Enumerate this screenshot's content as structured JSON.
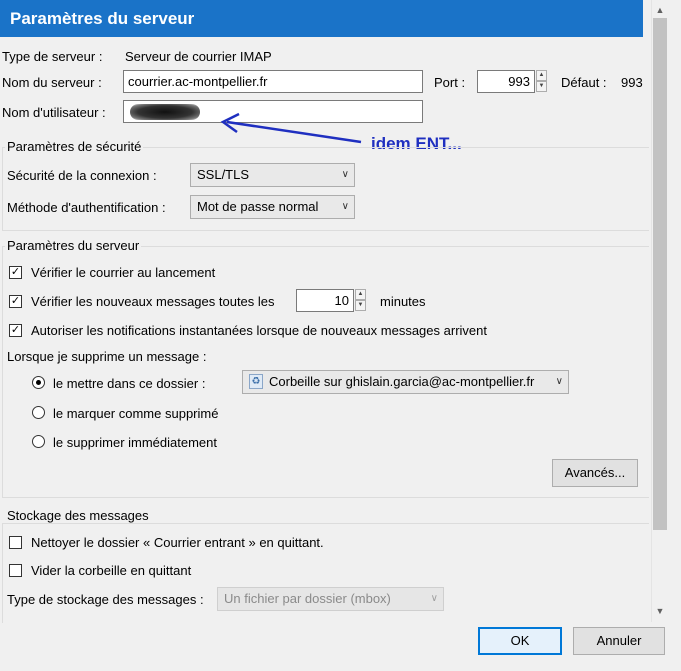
{
  "window": {
    "title": "Paramètres du serveur"
  },
  "server": {
    "type_label": "Type de serveur :",
    "type_value": "Serveur de courrier IMAP",
    "name_label": "Nom du serveur :",
    "name_value": "courrier.ac-montpellier.fr",
    "port_label": "Port :",
    "port_value": "993",
    "default_label": "Défaut :",
    "default_value": "993",
    "username_label": "Nom d'utilisateur :"
  },
  "annotation": {
    "text": "idem ENT...",
    "color": "#1f2fc0"
  },
  "security": {
    "group_label": "Paramètres de sécurité",
    "connection_label": "Sécurité de la connexion :",
    "connection_value": "SSL/TLS",
    "auth_label": "Méthode d'authentification :",
    "auth_value": "Mot de passe normal"
  },
  "server_settings": {
    "group_label": "Paramètres du serveur",
    "check_startup": {
      "label": "Vérifier le courrier au lancement",
      "checked": true
    },
    "check_new": {
      "label": "Vérifier les nouveaux messages toutes les",
      "checked": true,
      "value": "10",
      "unit": "minutes"
    },
    "notifications": {
      "label": "Autoriser les notifications instantanées lorsque de nouveaux messages arrivent",
      "checked": true
    },
    "delete_label": "Lorsque je supprime un message :",
    "delete_options": [
      {
        "label": "le mettre dans ce dossier :",
        "selected": true
      },
      {
        "label": "le marquer comme supprimé",
        "selected": false
      },
      {
        "label": "le supprimer immédiatement",
        "selected": false
      }
    ],
    "trash_folder": "Corbeille sur ghislain.garcia@ac-montpellier.fr",
    "advanced_button": "Avancés..."
  },
  "storage": {
    "group_label": "Stockage des messages",
    "cleanup_inbox": {
      "label": "Nettoyer le dossier « Courrier entrant » en quittant.",
      "checked": false
    },
    "empty_trash": {
      "label": "Vider la corbeille en quittant",
      "checked": false
    },
    "type_label": "Type de stockage des messages :",
    "type_value": "Un fichier par dossier (mbox)"
  },
  "buttons": {
    "ok": "OK",
    "cancel": "Annuler"
  },
  "colors": {
    "title_bar": "#1a73c8",
    "default_button_border": "#0078d7"
  }
}
